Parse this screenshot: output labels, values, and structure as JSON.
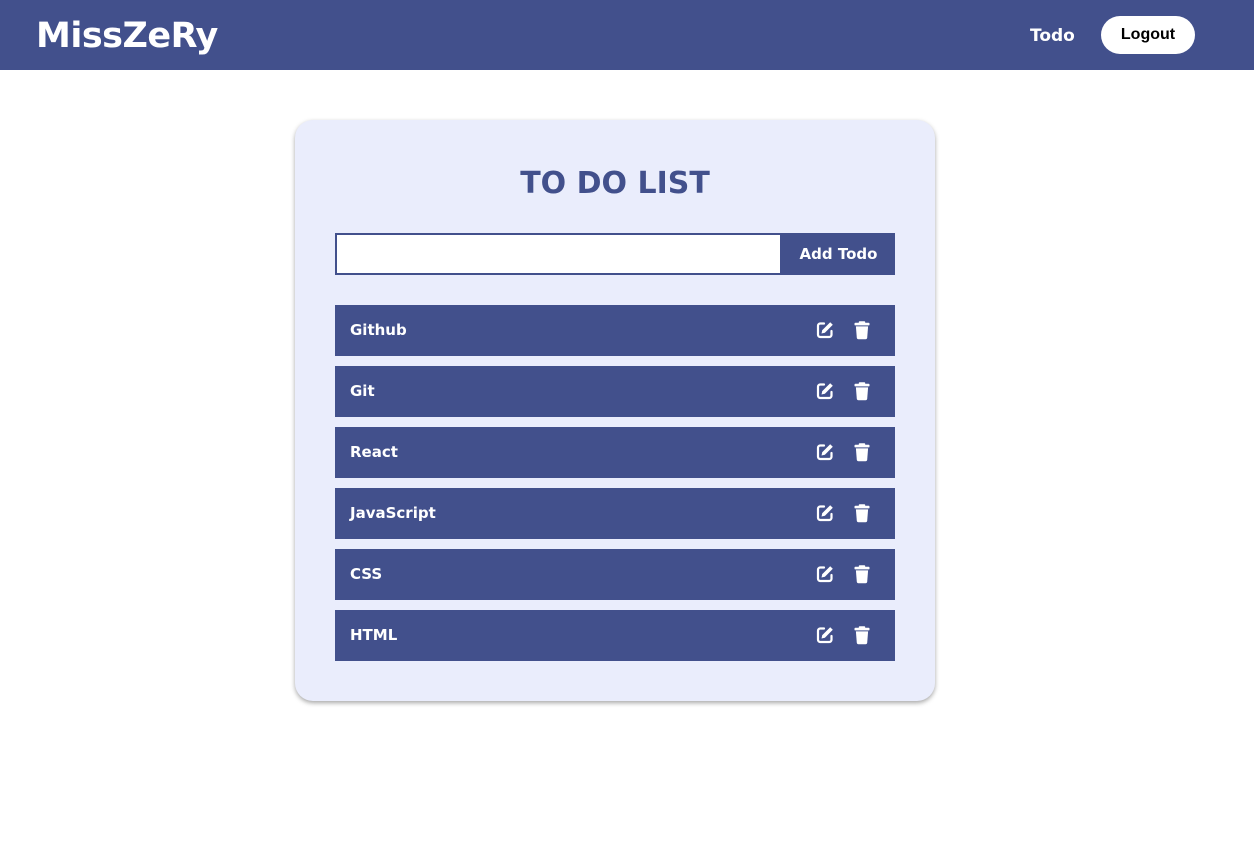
{
  "navbar": {
    "brand": "MissZeRy",
    "todo_link": "Todo",
    "logout_label": "Logout"
  },
  "card": {
    "title": "TO DO LIST",
    "input": {
      "value": "",
      "placeholder": ""
    },
    "add_label": "Add Todo"
  },
  "todos": [
    {
      "text": "Github"
    },
    {
      "text": "Git"
    },
    {
      "text": "React"
    },
    {
      "text": "JavaScript"
    },
    {
      "text": "CSS"
    },
    {
      "text": "HTML"
    }
  ],
  "icons": {
    "edit": "edit-icon",
    "delete": "trash-icon"
  },
  "colors": {
    "primary": "#42508c",
    "card_background": "#eaedfc",
    "page_background": "#ffffff",
    "text_on_primary": "#ffffff"
  }
}
